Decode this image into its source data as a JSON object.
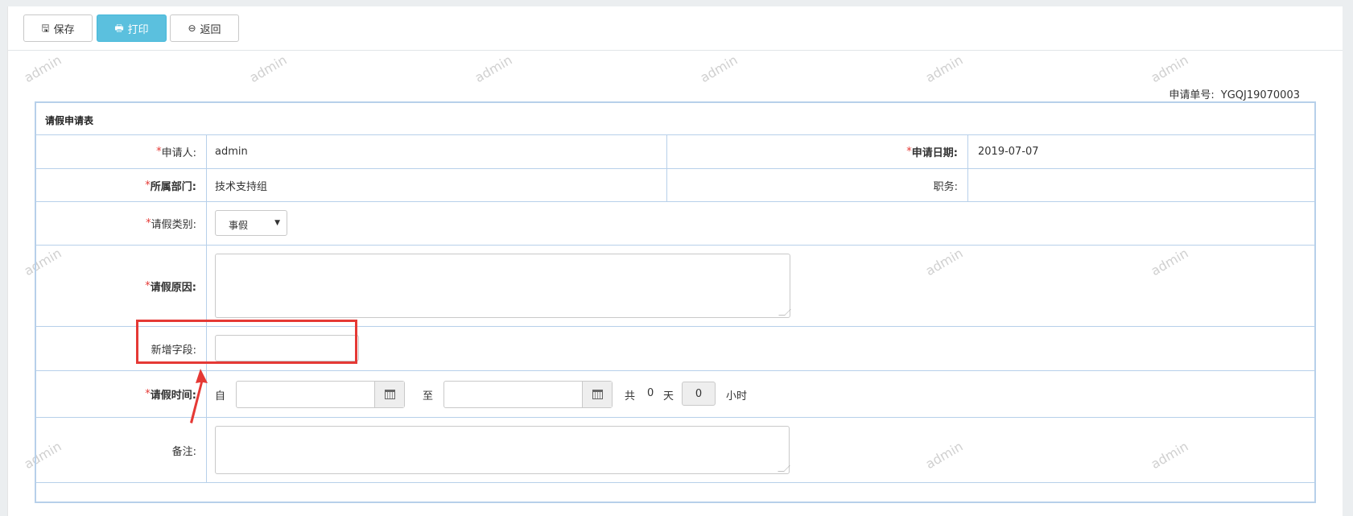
{
  "toolbar": {
    "save": {
      "icon": "save-icon",
      "label": "保存"
    },
    "print": {
      "icon": "print-icon",
      "label": "打印"
    },
    "back": {
      "icon": "back-circle-icon",
      "label": "返回"
    }
  },
  "watermark_text": "admin",
  "form_number": {
    "label": "申请单号:",
    "value": "YGQJ19070003"
  },
  "form": {
    "caption": "请假申请表",
    "required_mark": "*",
    "applicant": {
      "label": "申请人:",
      "value": "admin"
    },
    "apply_date": {
      "label": "申请日期:",
      "value": "2019-07-07"
    },
    "department": {
      "label": "所属部门:",
      "value": "技术支持组"
    },
    "position": {
      "label": "职务:",
      "value": ""
    },
    "leave_type": {
      "label": "请假类别:",
      "selected": "事假"
    },
    "leave_reason": {
      "label": "请假原因:",
      "value": ""
    },
    "new_field": {
      "label": "新增字段:",
      "value": ""
    },
    "leave_time": {
      "label": "请假时间:",
      "from_label": "自",
      "to_label": "至",
      "total_label": "共",
      "days_value": "0",
      "days_unit": "天",
      "hours_value": "0",
      "hours_unit": "小时"
    },
    "remarks": {
      "label": "备注:",
      "value": ""
    }
  },
  "colors": {
    "border": "#b7d0ea",
    "required": "#e53935",
    "print_button": "#5bc0de",
    "annotation": "#e53935"
  }
}
